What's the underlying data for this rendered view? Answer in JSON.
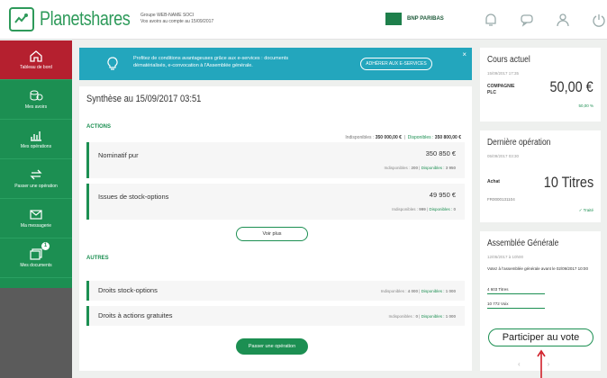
{
  "header": {
    "brand": "Planetshares",
    "company_line1": "Groupe WEB-NAME SOCI",
    "company_line2": "Vos avoirs au compte au 15/09/2017",
    "bank_name": "BNP PARIBAS"
  },
  "sidebar": {
    "items": [
      {
        "label": "Tableau de bord",
        "icon": "home-icon"
      },
      {
        "label": "Mes avoirs",
        "icon": "coins-icon"
      },
      {
        "label": "Mes opérations",
        "icon": "chart-icon"
      },
      {
        "label": "Passer une opération",
        "icon": "exchange-icon"
      },
      {
        "label": "Ma messagerie",
        "icon": "mail-icon"
      },
      {
        "label": "Mes documents",
        "icon": "documents-icon"
      }
    ],
    "documents_badge": "1"
  },
  "banner": {
    "text": "Profitez de conditions avantageuses grâce aux e-services : documents dématérialisés, e-convocation à l'Assemblée générale.",
    "button": "ADHÉRER AUX E-SERVICES",
    "close": "×"
  },
  "synthese": {
    "title": "Synthèse au 15/09/2017 03:51",
    "actions_label": "ACTIONS",
    "total_indispo_label": "Indisponibles :",
    "total_indispo": "350 000,00 €",
    "total_dispo_label": "Disponibles :",
    "total_dispo": "350 800,00 €",
    "rows_actions": [
      {
        "name": "Nominatif pur",
        "value": "350 850 €",
        "indispo": "200",
        "dispo": "3 950"
      },
      {
        "name": "Issues de stock-options",
        "value": "49 950 €",
        "indispo": "999",
        "dispo": "0"
      }
    ],
    "voir_plus": "Voir plus",
    "autres_label": "AUTRES",
    "rows_autres": [
      {
        "name": "Droits stock-options",
        "indispo": "4 000",
        "dispo": "1 000"
      },
      {
        "name": "Droits à actions gratuites",
        "indispo": "0",
        "dispo": "1 000"
      }
    ],
    "indispo_word": "Indisponibles :",
    "dispo_word": "Disponibles :",
    "passer": "Passer une opération"
  },
  "cours": {
    "title": "Cours actuel",
    "date": "15/09/2017 17:35",
    "company": "COMPAGNIE PLC",
    "price": "50,00 €",
    "change": "50,00 %"
  },
  "derniere": {
    "title": "Dernière opération",
    "date": "05/09/2017 03:30",
    "type": "Achat",
    "qty": "10 Titres",
    "ref": "FR0000131104",
    "status": "✓ Traité"
  },
  "assemblee": {
    "title": "Assemblée Générale",
    "date": "12/05/2017 à 10h00",
    "text": "Votez à l'assemblée générale avant le 02/09/2017 10:00",
    "titres": "4 603 Titres",
    "voix": "10 772 Voix",
    "vote_button": "Participer au vote",
    "prev": "‹",
    "next": "›"
  }
}
